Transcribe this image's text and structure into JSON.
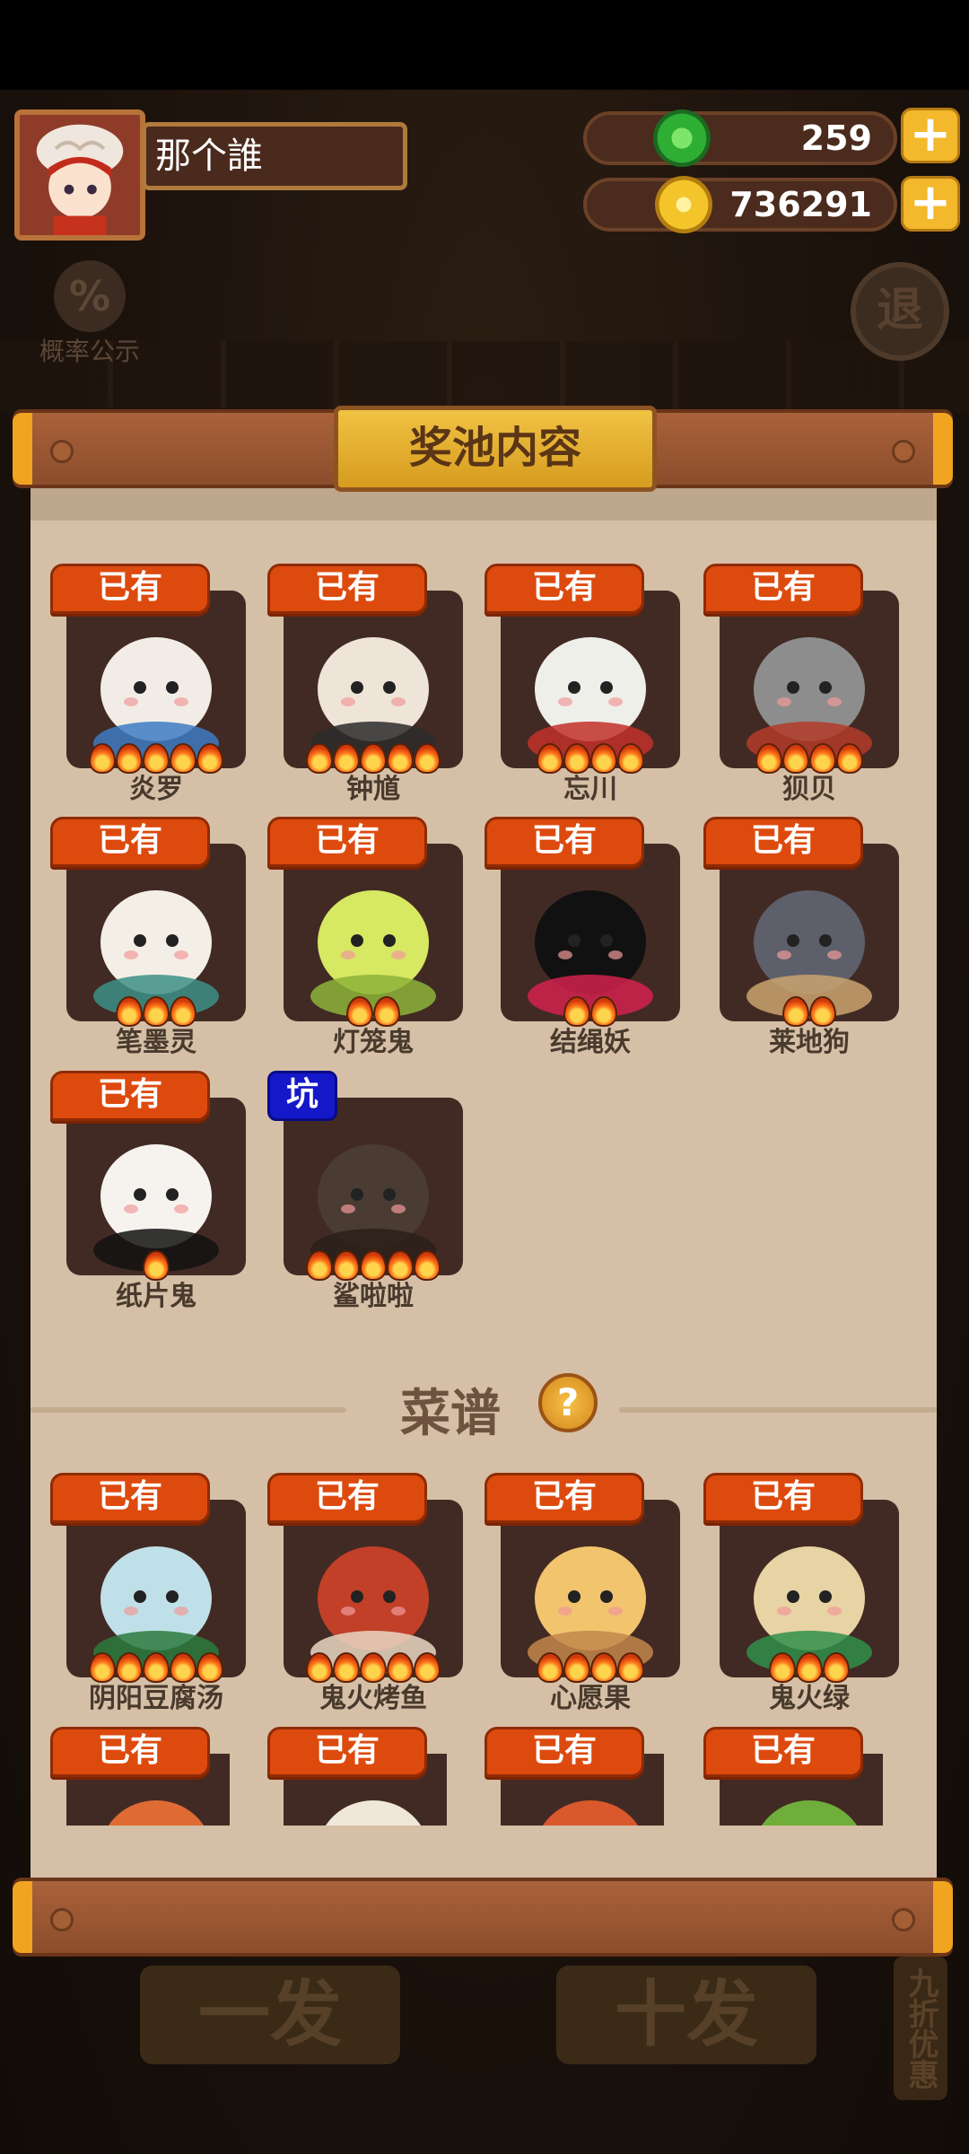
{
  "player": {
    "name": "那个誰"
  },
  "currency": {
    "jade": {
      "value": "259",
      "icon": "jade-coin-icon"
    },
    "gold": {
      "value": "736291",
      "icon": "gold-coin-icon"
    },
    "plus_label": "+"
  },
  "background": {
    "probability_symbol": "%",
    "probability_label": "概率公示",
    "exit_label": "退",
    "draw_one_label": "一发",
    "draw_ten_label": "十发",
    "discount_label": "九折优惠"
  },
  "panel": {
    "title": "奖池内容",
    "recipe_title": "菜谱",
    "help_symbol": "?"
  },
  "colors": {
    "badge_owned": "#dd4a0e",
    "badge_pit": "#1418c9",
    "panel_bg": "#d5c0a7",
    "title_gold": "#f1c243"
  },
  "characters": [
    {
      "name": "炎罗",
      "badge": "已有",
      "stars": 5
    },
    {
      "name": "钟馗",
      "badge": "已有",
      "stars": 5
    },
    {
      "name": "忘川",
      "badge": "已有",
      "stars": 4
    },
    {
      "name": "狈贝",
      "badge": "已有",
      "stars": 4
    },
    {
      "name": "笔墨灵",
      "badge": "已有",
      "stars": 3
    },
    {
      "name": "灯笼鬼",
      "badge": "已有",
      "stars": 2
    },
    {
      "name": "结绳妖",
      "badge": "已有",
      "stars": 2
    },
    {
      "name": "莱地狗",
      "badge": "已有",
      "stars": 2
    },
    {
      "name": "纸片鬼",
      "badge": "已有",
      "stars": 1
    },
    {
      "name": "鲨啦啦",
      "badge": "坑",
      "stars": 5
    }
  ],
  "recipes": [
    {
      "name": "阴阳豆腐汤",
      "badge": "已有",
      "stars": 5
    },
    {
      "name": "鬼火烤鱼",
      "badge": "已有",
      "stars": 5
    },
    {
      "name": "心愿果",
      "badge": "已有",
      "stars": 4
    },
    {
      "name": "鬼火绿",
      "badge": "已有",
      "stars": 3
    },
    {
      "name": "",
      "badge": "已有",
      "stars": 0
    },
    {
      "name": "",
      "badge": "已有",
      "stars": 0
    },
    {
      "name": "",
      "badge": "已有",
      "stars": 0
    },
    {
      "name": "",
      "badge": "已有",
      "stars": 0
    }
  ]
}
